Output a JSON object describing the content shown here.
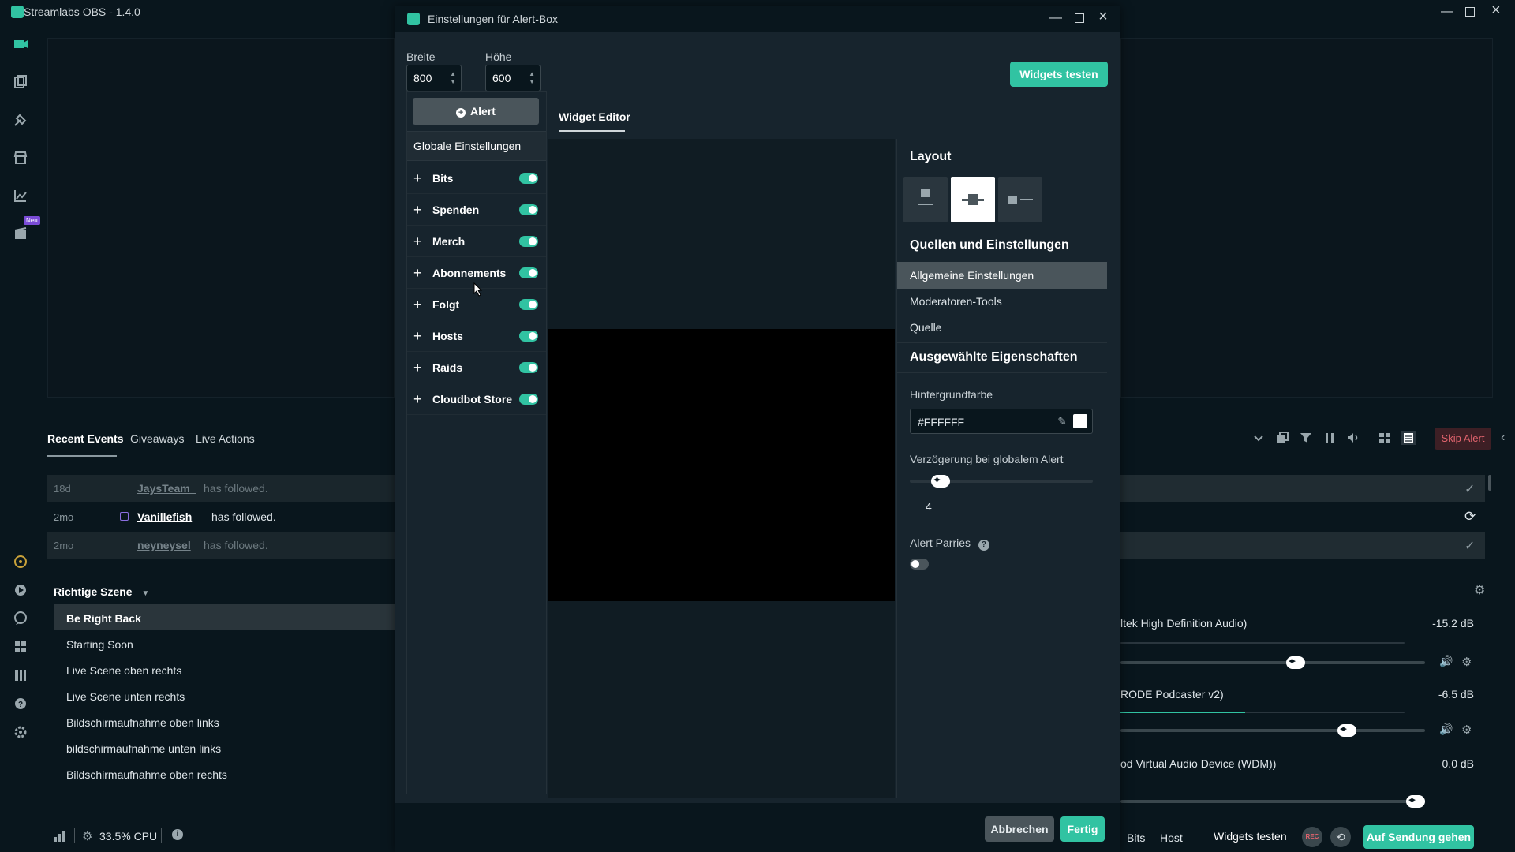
{
  "app": {
    "title": "Streamlabs OBS - 1.4.0",
    "new_badge": "Neu"
  },
  "events": {
    "tabs": [
      "Recent Events",
      "Giveaways",
      "Live Actions"
    ],
    "rows": [
      {
        "time": "18d",
        "name": "JaysTeam_",
        "text": "has followed."
      },
      {
        "time": "2mo",
        "name": "Vanillefish",
        "text": "has followed."
      },
      {
        "time": "2mo",
        "name": "neyneysel",
        "text": "has followed."
      }
    ],
    "skip_alert": "Skip Alert"
  },
  "scenes": {
    "collection": "Richtige Szene",
    "items": [
      "Be Right Back",
      "Starting Soon",
      "Live Scene oben rechts",
      "Live Scene unten rechts",
      "Bildschirmaufnahme oben links",
      "bildschirmaufnahme unten links",
      "Bildschirmaufnahme oben rechts"
    ]
  },
  "mixer": {
    "items": [
      {
        "name": "ltek High Definition Audio)",
        "db": "-15.2 dB",
        "level": 0.58,
        "meter": 0
      },
      {
        "name": "RODE Podcaster v2)",
        "db": "-6.5 dB",
        "level": 0.76,
        "meter": 0.44
      },
      {
        "name": "od Virtual Audio Device (WDM))",
        "db": "0.0 dB",
        "level": 1.0,
        "meter": 0
      }
    ]
  },
  "status": {
    "cpu": "33.5% CPU"
  },
  "bottom": {
    "bits": "Bits",
    "host": "Host",
    "widgets_test": "Widgets testen",
    "go_live": "Auf Sendung gehen",
    "rec": "REC"
  },
  "dialog": {
    "title": "Einstellungen für Alert-Box",
    "width_label": "Breite",
    "width_value": "800",
    "height_label": "Höhe",
    "height_value": "600",
    "test_button": "Widgets testen",
    "alert_button": "Alert",
    "global_settings": "Globale Einstellungen",
    "types": [
      {
        "name": "Bits",
        "enabled": true
      },
      {
        "name": "Spenden",
        "enabled": true
      },
      {
        "name": "Merch",
        "enabled": true
      },
      {
        "name": "Abonnements",
        "enabled": true
      },
      {
        "name": "Folgt",
        "enabled": true
      },
      {
        "name": "Hosts",
        "enabled": true
      },
      {
        "name": "Raids",
        "enabled": true
      },
      {
        "name": "Cloudbot Store",
        "enabled": true
      }
    ],
    "editor_tab": "Widget Editor",
    "layout_title": "Layout",
    "sources_title": "Quellen und Einstellungen",
    "sources": [
      "Allgemeine Einstellungen",
      "Moderatoren-Tools",
      "Quelle"
    ],
    "props_title": "Ausgewählte Eigenschaften",
    "bg_color_label": "Hintergrundfarbe",
    "bg_color_value": "#FFFFFF",
    "delay_label": "Verzögerung bei globalem Alert",
    "delay_value": "4",
    "delay_level": 0.13,
    "parries_label": "Alert Parries",
    "parries_enabled": false,
    "cancel": "Abbrechen",
    "done": "Fertig"
  },
  "colors": {
    "accent": "#31c3a2",
    "background": "#09161d",
    "panel": "#17242d",
    "danger": "#e2646e"
  }
}
